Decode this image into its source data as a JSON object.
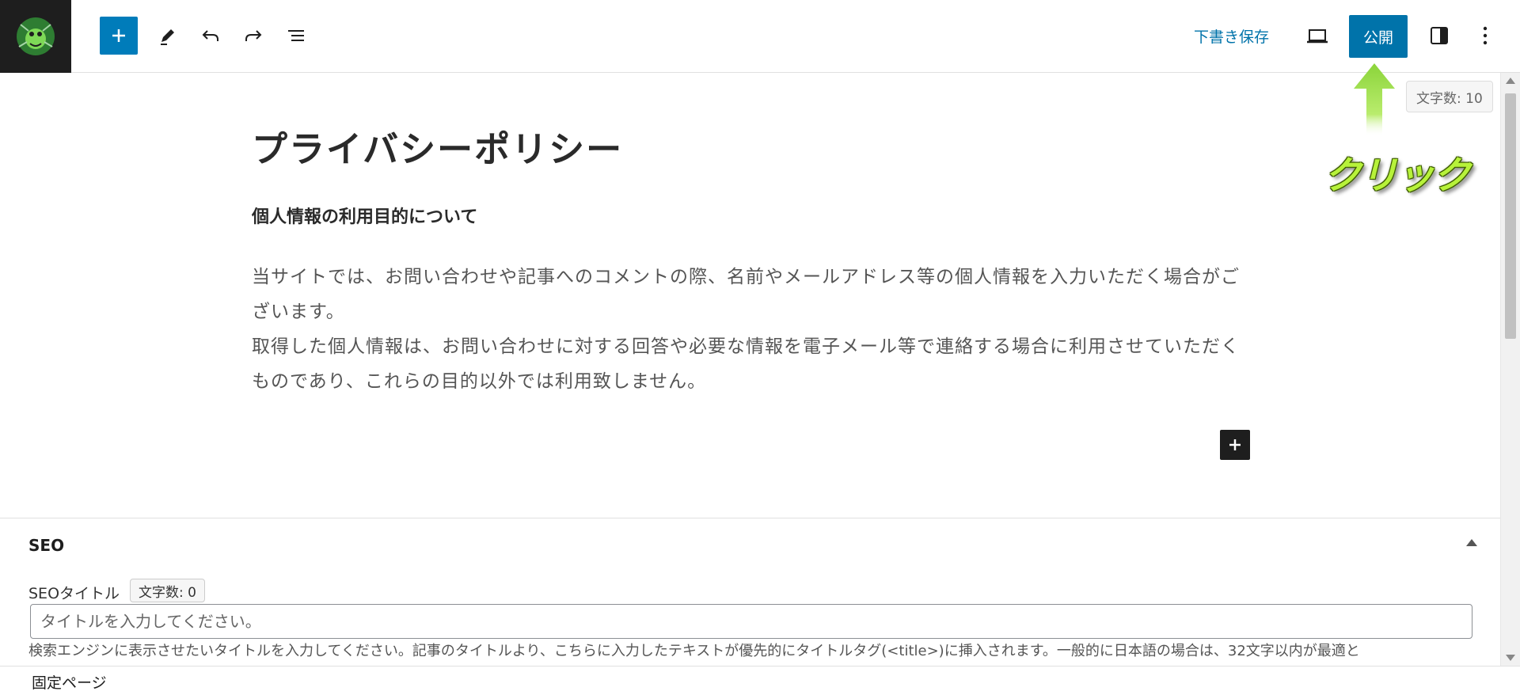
{
  "toolbar": {
    "logo_icon": "site-logo-icon",
    "add_block_icon": "plus-icon",
    "tools_icon": "pencil-icon",
    "undo_icon": "undo-icon",
    "redo_icon": "redo-icon",
    "document_overview_icon": "list-view-icon",
    "save_draft_label": "下書き保存",
    "view_icon": "laptop-icon",
    "publish_label": "公開",
    "settings_icon": "sidebar-toggle-icon",
    "options_icon": "more-vertical-icon"
  },
  "editor": {
    "title": "プライバシーポリシー",
    "heading": "個人情報の利用目的について",
    "paragraph_lines": [
      "当サイトでは、お問い合わせや記事へのコメントの際、名前やメールアドレス等の個人情報を入力いただく場合がご",
      "ざいます。",
      "取得した個人情報は、お問い合わせに対する回答や必要な情報を電子メール等で連絡する場合に利用させていただく",
      "ものであり、これらの目的以外では利用致しません。"
    ],
    "char_count": "文字数: 10",
    "inline_add_icon": "plus-icon"
  },
  "annotation": {
    "label": "クリック",
    "arrow_icon": "arrow-up-icon",
    "color": "#b7f23a"
  },
  "seo": {
    "heading": "SEO",
    "toggle_icon": "caret-up-icon",
    "title_label": "SEOタイトル",
    "title_count": "文字数: 0",
    "title_placeholder": "タイトルを入力してください。",
    "title_value": "",
    "help_text": "検索エンジンに表示させたいタイトルを入力してください。記事のタイトルより、こちらに入力したテキストが優先的にタイトルタグ(<title>)に挿入されます。一般的に日本語の場合は、32文字以内が最適と"
  },
  "footer": {
    "breadcrumb": "固定ページ"
  },
  "colors": {
    "accent": "#007cba",
    "publish": "#0073aa",
    "dark": "#1e1e1e"
  }
}
